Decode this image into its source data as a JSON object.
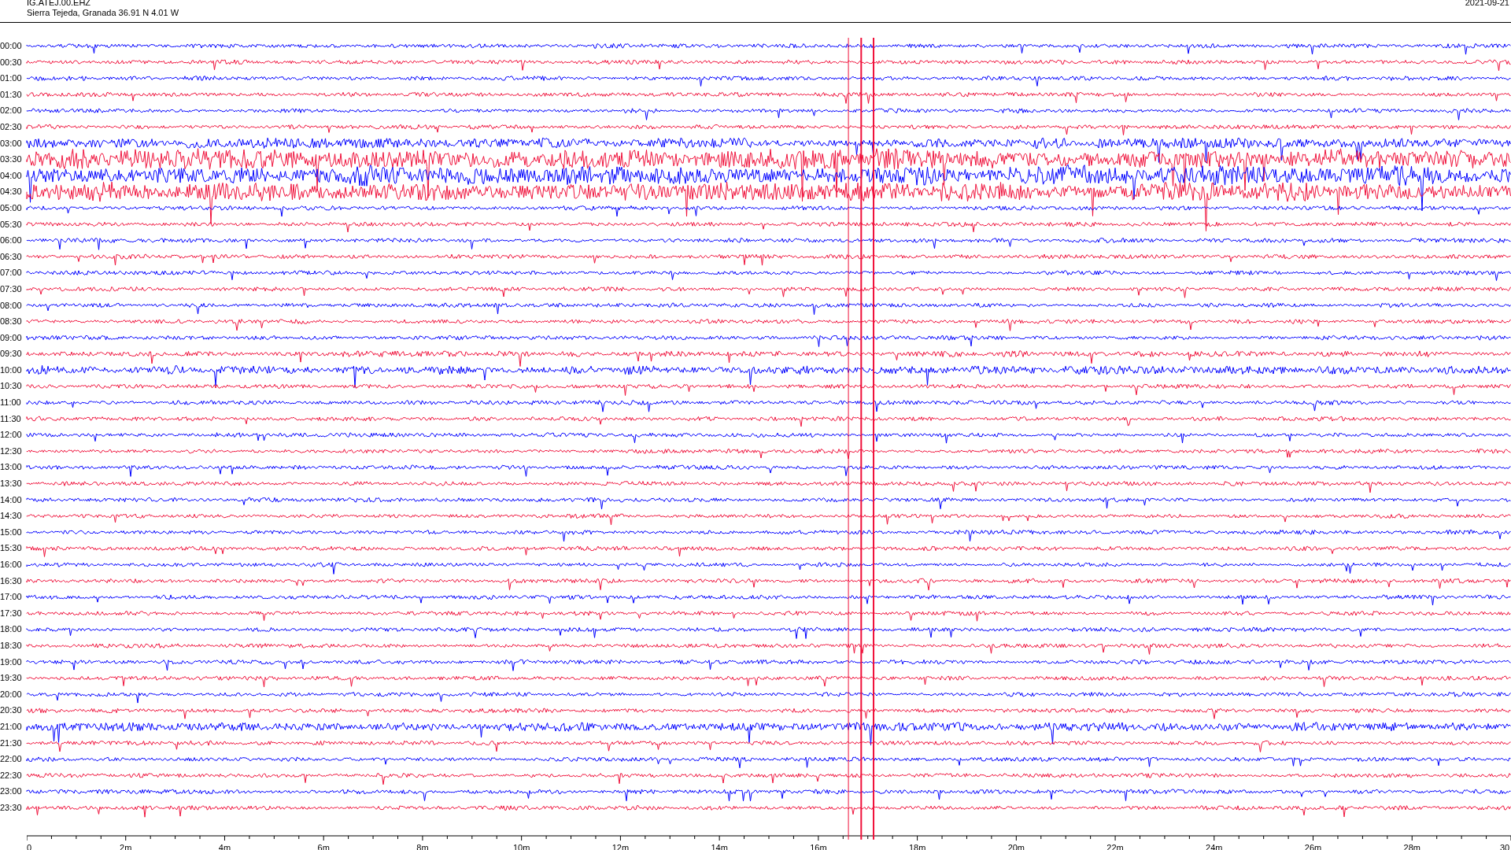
{
  "header": {
    "station": "IG.ATEJ.00.EHZ",
    "location": "Sierra Tejeda, Granada  36.91 N 4.01 W",
    "date": "2021-09-21"
  },
  "traces": [
    {
      "label": "00:00",
      "color": "#0000ff"
    },
    {
      "label": "00:30",
      "color": "#f0103a"
    },
    {
      "label": "01:00",
      "color": "#0000ff"
    },
    {
      "label": "01:30",
      "color": "#f0103a"
    },
    {
      "label": "02:00",
      "color": "#0000ff"
    },
    {
      "label": "02:30",
      "color": "#f0103a"
    },
    {
      "label": "03:00",
      "color": "#0000ff"
    },
    {
      "label": "03:30",
      "color": "#f0103a"
    },
    {
      "label": "04:00",
      "color": "#0000ff"
    },
    {
      "label": "04:30",
      "color": "#f0103a"
    },
    {
      "label": "05:00",
      "color": "#0000ff"
    },
    {
      "label": "05:30",
      "color": "#f0103a"
    },
    {
      "label": "06:00",
      "color": "#0000ff"
    },
    {
      "label": "06:30",
      "color": "#f0103a"
    },
    {
      "label": "07:00",
      "color": "#0000ff"
    },
    {
      "label": "07:30",
      "color": "#f0103a"
    },
    {
      "label": "08:00",
      "color": "#0000ff"
    },
    {
      "label": "08:30",
      "color": "#f0103a"
    },
    {
      "label": "09:00",
      "color": "#0000ff"
    },
    {
      "label": "09:30",
      "color": "#f0103a"
    },
    {
      "label": "10:00",
      "color": "#0000ff"
    },
    {
      "label": "10:30",
      "color": "#f0103a"
    },
    {
      "label": "11:00",
      "color": "#0000ff"
    },
    {
      "label": "11:30",
      "color": "#f0103a"
    },
    {
      "label": "12:00",
      "color": "#0000ff"
    },
    {
      "label": "12:30",
      "color": "#f0103a"
    },
    {
      "label": "13:00",
      "color": "#0000ff"
    },
    {
      "label": "13:30",
      "color": "#f0103a"
    },
    {
      "label": "14:00",
      "color": "#0000ff"
    },
    {
      "label": "14:30",
      "color": "#f0103a"
    },
    {
      "label": "15:00",
      "color": "#0000ff"
    },
    {
      "label": "15:30",
      "color": "#f0103a"
    },
    {
      "label": "16:00",
      "color": "#0000ff"
    },
    {
      "label": "16:30",
      "color": "#f0103a"
    },
    {
      "label": "17:00",
      "color": "#0000ff"
    },
    {
      "label": "17:30",
      "color": "#f0103a"
    },
    {
      "label": "18:00",
      "color": "#0000ff"
    },
    {
      "label": "18:30",
      "color": "#f0103a"
    },
    {
      "label": "19:00",
      "color": "#0000ff"
    },
    {
      "label": "19:30",
      "color": "#f0103a"
    },
    {
      "label": "20:00",
      "color": "#0000ff"
    },
    {
      "label": "20:30",
      "color": "#f0103a"
    },
    {
      "label": "21:00",
      "color": "#0000ff"
    },
    {
      "label": "21:30",
      "color": "#f0103a"
    },
    {
      "label": "22:00",
      "color": "#0000ff"
    },
    {
      "label": "22:30",
      "color": "#f0103a"
    },
    {
      "label": "23:00",
      "color": "#0000ff"
    },
    {
      "label": "23:30",
      "color": "#f0103a"
    }
  ],
  "x_axis": {
    "ticks": [
      "0",
      "2m",
      "4m",
      "6m",
      "8m",
      "10m",
      "12m",
      "14m",
      "16m",
      "18m",
      "20m",
      "22m",
      "24m",
      "26m",
      "28m",
      "30"
    ]
  }
}
